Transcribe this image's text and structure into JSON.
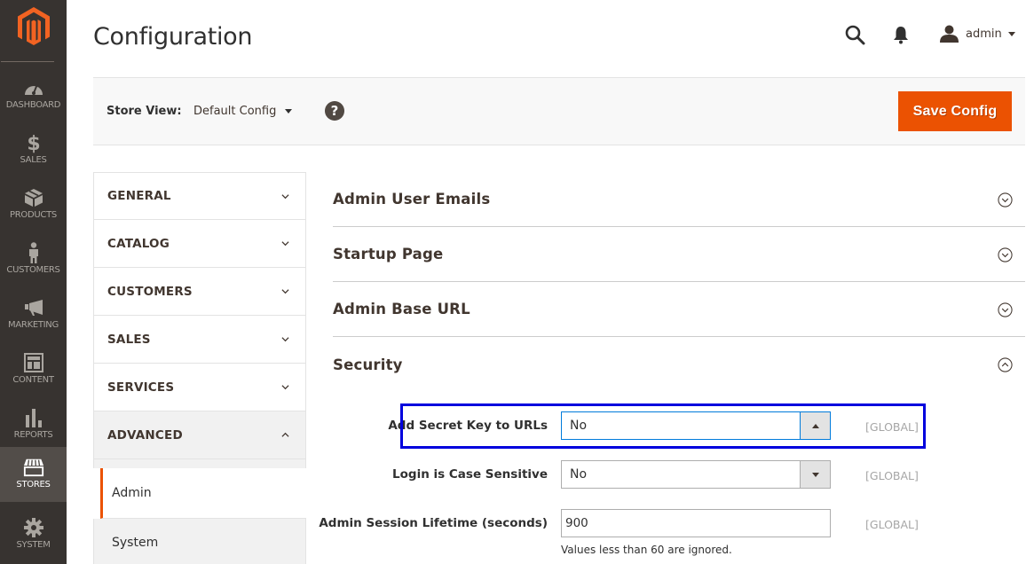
{
  "nav": {
    "items": [
      {
        "id": "dashboard",
        "label": "DASHBOARD",
        "icon": "dashboard-gauge-icon"
      },
      {
        "id": "sales",
        "label": "SALES",
        "icon": "dollar-icon"
      },
      {
        "id": "products",
        "label": "PRODUCTS",
        "icon": "box-icon"
      },
      {
        "id": "customers",
        "label": "CUSTOMERS",
        "icon": "person-icon"
      },
      {
        "id": "marketing",
        "label": "MARKETING",
        "icon": "megaphone-icon"
      },
      {
        "id": "content",
        "label": "CONTENT",
        "icon": "layout-icon"
      },
      {
        "id": "reports",
        "label": "REPORTS",
        "icon": "bar-chart-icon"
      },
      {
        "id": "stores",
        "label": "STORES",
        "icon": "storefront-icon",
        "active": true
      },
      {
        "id": "system",
        "label": "SYSTEM",
        "icon": "gear-icon"
      }
    ]
  },
  "header": {
    "title": "Configuration",
    "user": "admin"
  },
  "store_view": {
    "label": "Store View:",
    "value": "Default Config",
    "help": "?"
  },
  "actions": {
    "save_label": "Save Config"
  },
  "config_tabs": [
    {
      "label": "GENERAL",
      "expanded": false
    },
    {
      "label": "CATALOG",
      "expanded": false
    },
    {
      "label": "CUSTOMERS",
      "expanded": false
    },
    {
      "label": "SALES",
      "expanded": false
    },
    {
      "label": "SERVICES",
      "expanded": false
    },
    {
      "label": "ADVANCED",
      "expanded": true,
      "children": [
        {
          "label": "Admin",
          "active": true
        },
        {
          "label": "System",
          "active": false
        }
      ]
    }
  ],
  "sections": [
    {
      "title": "Admin User Emails",
      "expanded": false
    },
    {
      "title": "Startup Page",
      "expanded": false
    },
    {
      "title": "Admin Base URL",
      "expanded": false
    },
    {
      "title": "Security",
      "expanded": true
    }
  ],
  "security_fields": [
    {
      "label": "Add Secret Key to URLs",
      "type": "select",
      "value": "No",
      "scope": "[GLOBAL]",
      "state": "open-focused",
      "highlighted": true
    },
    {
      "label": "Login is Case Sensitive",
      "type": "select",
      "value": "No",
      "scope": "[GLOBAL]"
    },
    {
      "label": "Admin Session Lifetime (seconds)",
      "type": "text",
      "value": "900",
      "scope": "[GLOBAL]",
      "note": "Values less than 60 are ignored."
    }
  ],
  "colors": {
    "accent": "#eb5202",
    "nav_bg": "#373330",
    "nav_active": "#524d49",
    "highlight_box": "#0000dd",
    "focus_border": "#007bdb"
  }
}
